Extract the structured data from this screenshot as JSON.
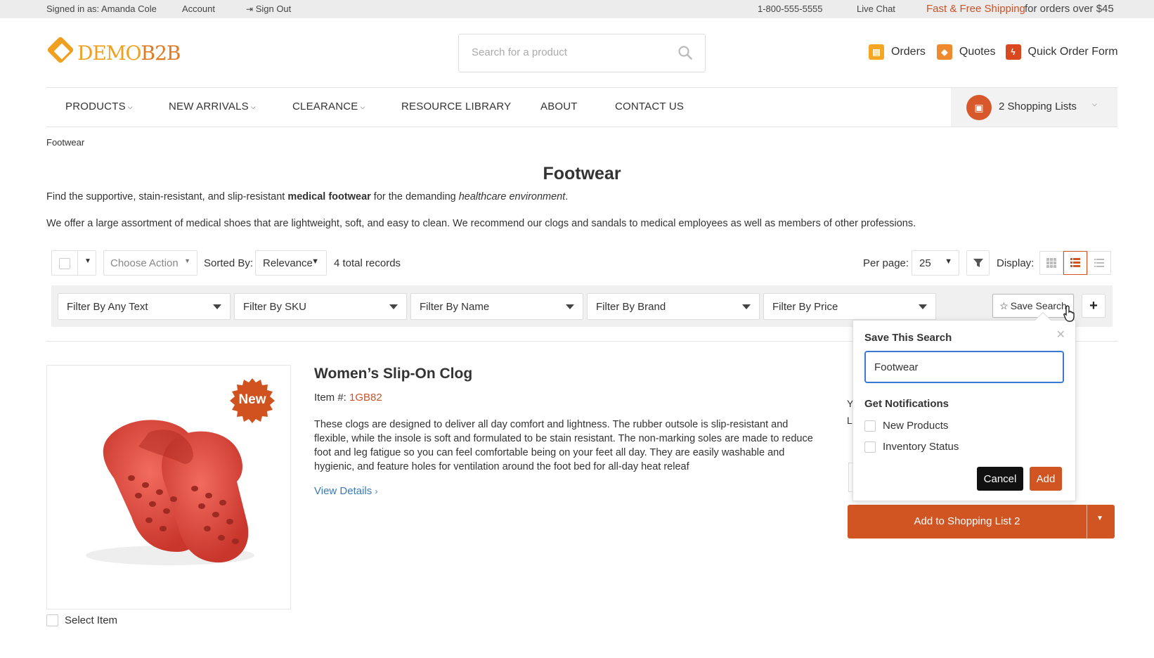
{
  "topbar": {
    "signed_in": "Signed in as: Amanda Cole",
    "account": "Account",
    "sign_out": "Sign Out",
    "phone": "1-800-555-5555",
    "live_chat": "Live Chat",
    "promo_highlight": "Fast & Free Shipping",
    "promo_rest": "for orders over $45"
  },
  "logo": {
    "part1": "DEMO",
    "part2": "B2B"
  },
  "search": {
    "placeholder": "Search for a product"
  },
  "header_links": [
    {
      "label": "Orders",
      "icon": "orders-icon",
      "color": "#f5a623"
    },
    {
      "label": "Quotes",
      "icon": "tag-icon",
      "color": "#f08a2e"
    },
    {
      "label": "Quick Order Form",
      "icon": "lightning-icon",
      "color": "#d9481f"
    }
  ],
  "nav": {
    "items": [
      "PRODUCTS",
      "NEW ARRIVALS",
      "CLEARANCE",
      "RESOURCE LIBRARY",
      "ABOUT",
      "CONTACT US"
    ],
    "shopping_lists": "2 Shopping Lists"
  },
  "breadcrumb": "Footwear",
  "page": {
    "title": "Footwear",
    "desc1_a": "Find the supportive, stain-resistant, and slip-resistant ",
    "desc1_b": "medical footwear",
    "desc1_c": " for the demanding ",
    "desc1_d": "healthcare environment",
    "desc1_e": ".",
    "desc2": "We offer a large assortment of medical shoes that are lightweight, soft, and easy to clean. We recommend our clogs and sandals to medical employees as well as members of other professions."
  },
  "toolbar": {
    "choose_action": "Choose Action",
    "sorted_by": "Sorted By:",
    "sort_value": "Relevance",
    "total": "4 total records",
    "per_page_label": "Per page:",
    "per_page": "25",
    "display_label": "Display:"
  },
  "filters": [
    "Filter By Any Text",
    "Filter By SKU",
    "Filter By Name",
    "Filter By Brand",
    "Filter By Price"
  ],
  "save_search": "Save Search",
  "plus": "+",
  "product": {
    "badge": "New",
    "name": "Women’s Slip-On Clog",
    "item_label": "Item #: ",
    "item_no": "1GB82",
    "description": "These clogs are designed to deliver all day comfort and lightness. The rubber outsole is slip-resistant and flexible, while the insole is soft and formulated to be stain resistant. The non-marking soles are made to reduce foot and leg fatigue so you can feel comfortable being on your feet all day. They are easily washable and hygienic, and feature holes for ventilation around the foot bed for all-day heat releaf",
    "view_details": "View Details",
    "select_item": "Select Item",
    "partial1": "Y",
    "partial2": "L",
    "add_to_list": "Add to Shopping List 2"
  },
  "popover": {
    "title": "Save This Search",
    "input_value": "Footwear",
    "notifications": "Get Notifications",
    "opt1": "New Products",
    "opt2": "Inventory Status",
    "cancel": "Cancel",
    "add": "Add"
  },
  "colors": {
    "accent": "#d15523",
    "link": "#3a7ab8",
    "brand": "#f0a020"
  }
}
